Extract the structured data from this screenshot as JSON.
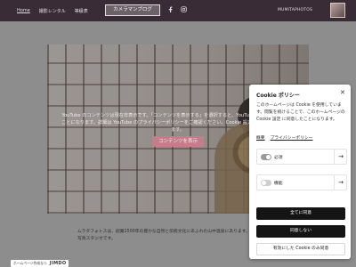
{
  "header": {
    "nav": [
      "Home",
      "撮影レンタル",
      "等級表"
    ],
    "blog_button": "カメラマンブログ",
    "brand": "MUMITAPHOTOS",
    "social_icons": [
      "facebook-icon",
      "instagram-icon"
    ]
  },
  "video": {
    "notice": "YouTube のコンテンツは現在非表示です。「コンテンツを表示する」を選択すると、YouTube の情報に同意することになります。詳細は YouTube のプライバシーポリシーをご確認ください。Cookie 設定はいつでも変更できます。",
    "show_button": "コンテンツを表示"
  },
  "footer": {
    "text": "ムラタフォトスは、創業1500年の豊かな自然と伝統文化にあふれた山中温泉にあります。ムラタアートで、ちょっとだけ、小さなちいさな写真スタジオです。",
    "jimdo_prefix": "ホームページ作成なら",
    "jimdo_brand": "JIMDO"
  },
  "cookie": {
    "title": "Cookie ポリシー",
    "description": "このホームページは Cookie を使用しています。閲覧を続けることで、このホームページの Cookie 設定 に同意したことになります。",
    "links": [
      "概要",
      "プライバシーポリシー"
    ],
    "rows": [
      {
        "label": "必須",
        "on": true
      },
      {
        "label": "機能",
        "on": false
      }
    ],
    "accept_all": "全てに同意",
    "decline": "同意しない",
    "accept_selected": "有効にした Cookie のみ同意"
  }
}
